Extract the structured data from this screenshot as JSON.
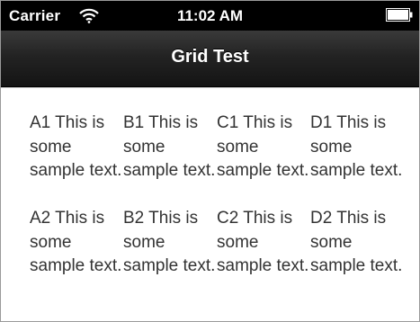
{
  "status_bar": {
    "carrier": "Carrier",
    "time": "11:02 AM"
  },
  "nav_bar": {
    "title": "Grid Test"
  },
  "grid": {
    "rows": [
      [
        "A1 This is some sample text.",
        "B1 This is some sample text.",
        "C1 This is some sample text.",
        "D1 This is some sample text."
      ],
      [
        "A2 This is some sample text.",
        "B2 This is some sample text.",
        "C2 This is some sample text.",
        "D2 This is some sample text."
      ]
    ]
  },
  "colors": {
    "status_bar_bg": "#000000",
    "nav_bar_top": "#3a3a3a",
    "nav_bar_bottom": "#141414",
    "text": "#333333"
  },
  "icons": {
    "signal": "wifi-icon",
    "battery": "battery-icon"
  }
}
